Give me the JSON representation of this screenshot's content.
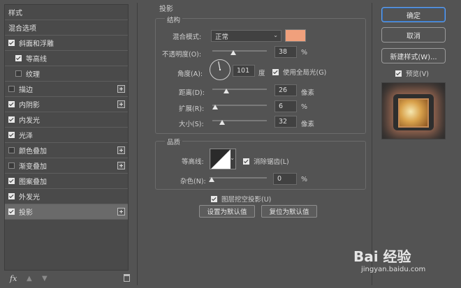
{
  "sidebar": {
    "items": [
      {
        "label": "样式",
        "checkbox": false,
        "checked": false,
        "plus": false,
        "indent": 0,
        "selected": false
      },
      {
        "label": "混合选项",
        "checkbox": false,
        "checked": false,
        "plus": false,
        "indent": 0,
        "selected": false
      },
      {
        "label": "斜面和浮雕",
        "checkbox": true,
        "checked": true,
        "plus": false,
        "indent": 0,
        "selected": false
      },
      {
        "label": "等高线",
        "checkbox": true,
        "checked": true,
        "plus": false,
        "indent": 1,
        "selected": false
      },
      {
        "label": "纹理",
        "checkbox": true,
        "checked": false,
        "plus": false,
        "indent": 1,
        "selected": false
      },
      {
        "label": "描边",
        "checkbox": true,
        "checked": false,
        "plus": true,
        "indent": 0,
        "selected": false
      },
      {
        "label": "内阴影",
        "checkbox": true,
        "checked": true,
        "plus": true,
        "indent": 0,
        "selected": false
      },
      {
        "label": "内发光",
        "checkbox": true,
        "checked": true,
        "plus": false,
        "indent": 0,
        "selected": false
      },
      {
        "label": "光泽",
        "checkbox": true,
        "checked": true,
        "plus": false,
        "indent": 0,
        "selected": false
      },
      {
        "label": "颜色叠加",
        "checkbox": true,
        "checked": false,
        "plus": true,
        "indent": 0,
        "selected": false
      },
      {
        "label": "渐变叠加",
        "checkbox": true,
        "checked": false,
        "plus": true,
        "indent": 0,
        "selected": false
      },
      {
        "label": "图案叠加",
        "checkbox": true,
        "checked": true,
        "plus": false,
        "indent": 0,
        "selected": false
      },
      {
        "label": "外发光",
        "checkbox": true,
        "checked": true,
        "plus": false,
        "indent": 0,
        "selected": false
      },
      {
        "label": "投影",
        "checkbox": true,
        "checked": true,
        "plus": true,
        "indent": 0,
        "selected": true
      }
    ],
    "bottom_fx": "fx"
  },
  "panel": {
    "title": "投影",
    "structure": {
      "title": "结构",
      "blend_mode_label": "混合模式:",
      "blend_mode_value": "正常",
      "shadow_color": "#f0a07c",
      "opacity_label": "不透明度(O):",
      "opacity_value": "38",
      "opacity_unit": "%",
      "opacity_level": 0.38,
      "angle_label": "角度(A):",
      "angle_value": "101",
      "angle_unit": "度",
      "global_light_label": "使用全局光(G)",
      "global_light_checked": true,
      "distance_label": "距离(D):",
      "distance_value": "26",
      "distance_unit": "像素",
      "spread_label": "扩展(R):",
      "spread_value": "6",
      "spread_unit": "%",
      "size_label": "大小(S):",
      "size_value": "32",
      "size_unit": "像素"
    },
    "quality": {
      "title": "品质",
      "contour_label": "等高线:",
      "antialias_label": "消除锯齿(L)",
      "antialias_checked": true,
      "noise_label": "杂色(N):",
      "noise_value": "0",
      "noise_unit": "%"
    },
    "knockout_label": "图层挖空投影(U)",
    "knockout_checked": true,
    "set_default_label": "设置为默认值",
    "reset_default_label": "复位为默认值"
  },
  "actions": {
    "ok_label": "确定",
    "cancel_label": "取消",
    "new_style_label": "新建样式(W)...",
    "preview_label": "预览(V)",
    "preview_checked": true
  },
  "watermark": {
    "brand": "Bai 经验",
    "url": "jingyan.baidu.com"
  }
}
